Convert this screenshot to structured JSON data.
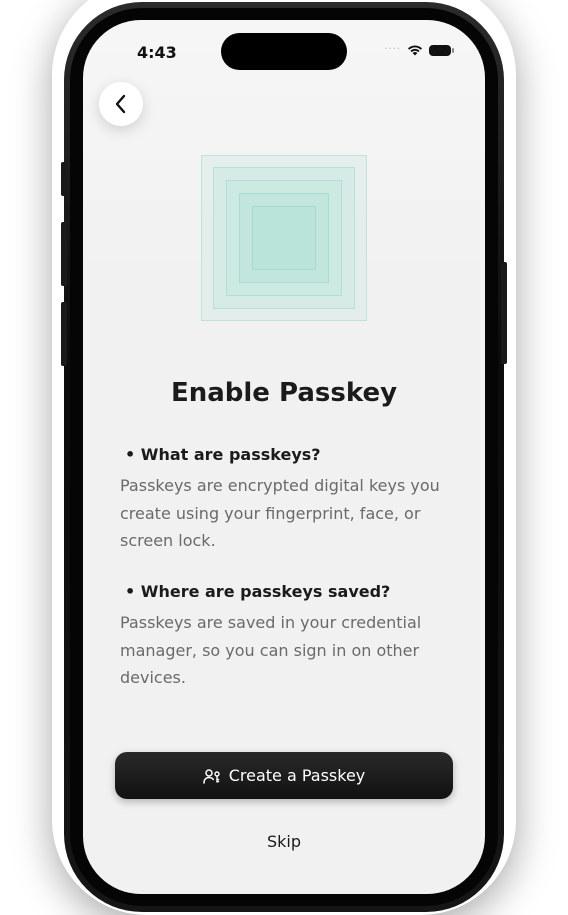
{
  "status_bar": {
    "time": "4:43",
    "signal_indicator": "····",
    "icons": [
      "wifi-icon",
      "battery-icon"
    ]
  },
  "nav": {
    "back_icon": "chevron-left-icon"
  },
  "illustration": {
    "icon": "nested-squares-icon",
    "accent_color": "#78cdb9"
  },
  "content": {
    "title": "Enable Passkey",
    "sections": [
      {
        "heading": "• What are passkeys?",
        "body": "Passkeys are encrypted digital keys you create using your fingerprint, face, or screen lock."
      },
      {
        "heading": "• Where are passkeys saved?",
        "body": "Passkeys are saved in your credential manager, so you can sign in on other devices."
      }
    ]
  },
  "actions": {
    "primary_label": "Create a Passkey",
    "primary_icon": "user-key-icon",
    "primary_color": "#1a1a1a",
    "secondary_label": "Skip"
  }
}
